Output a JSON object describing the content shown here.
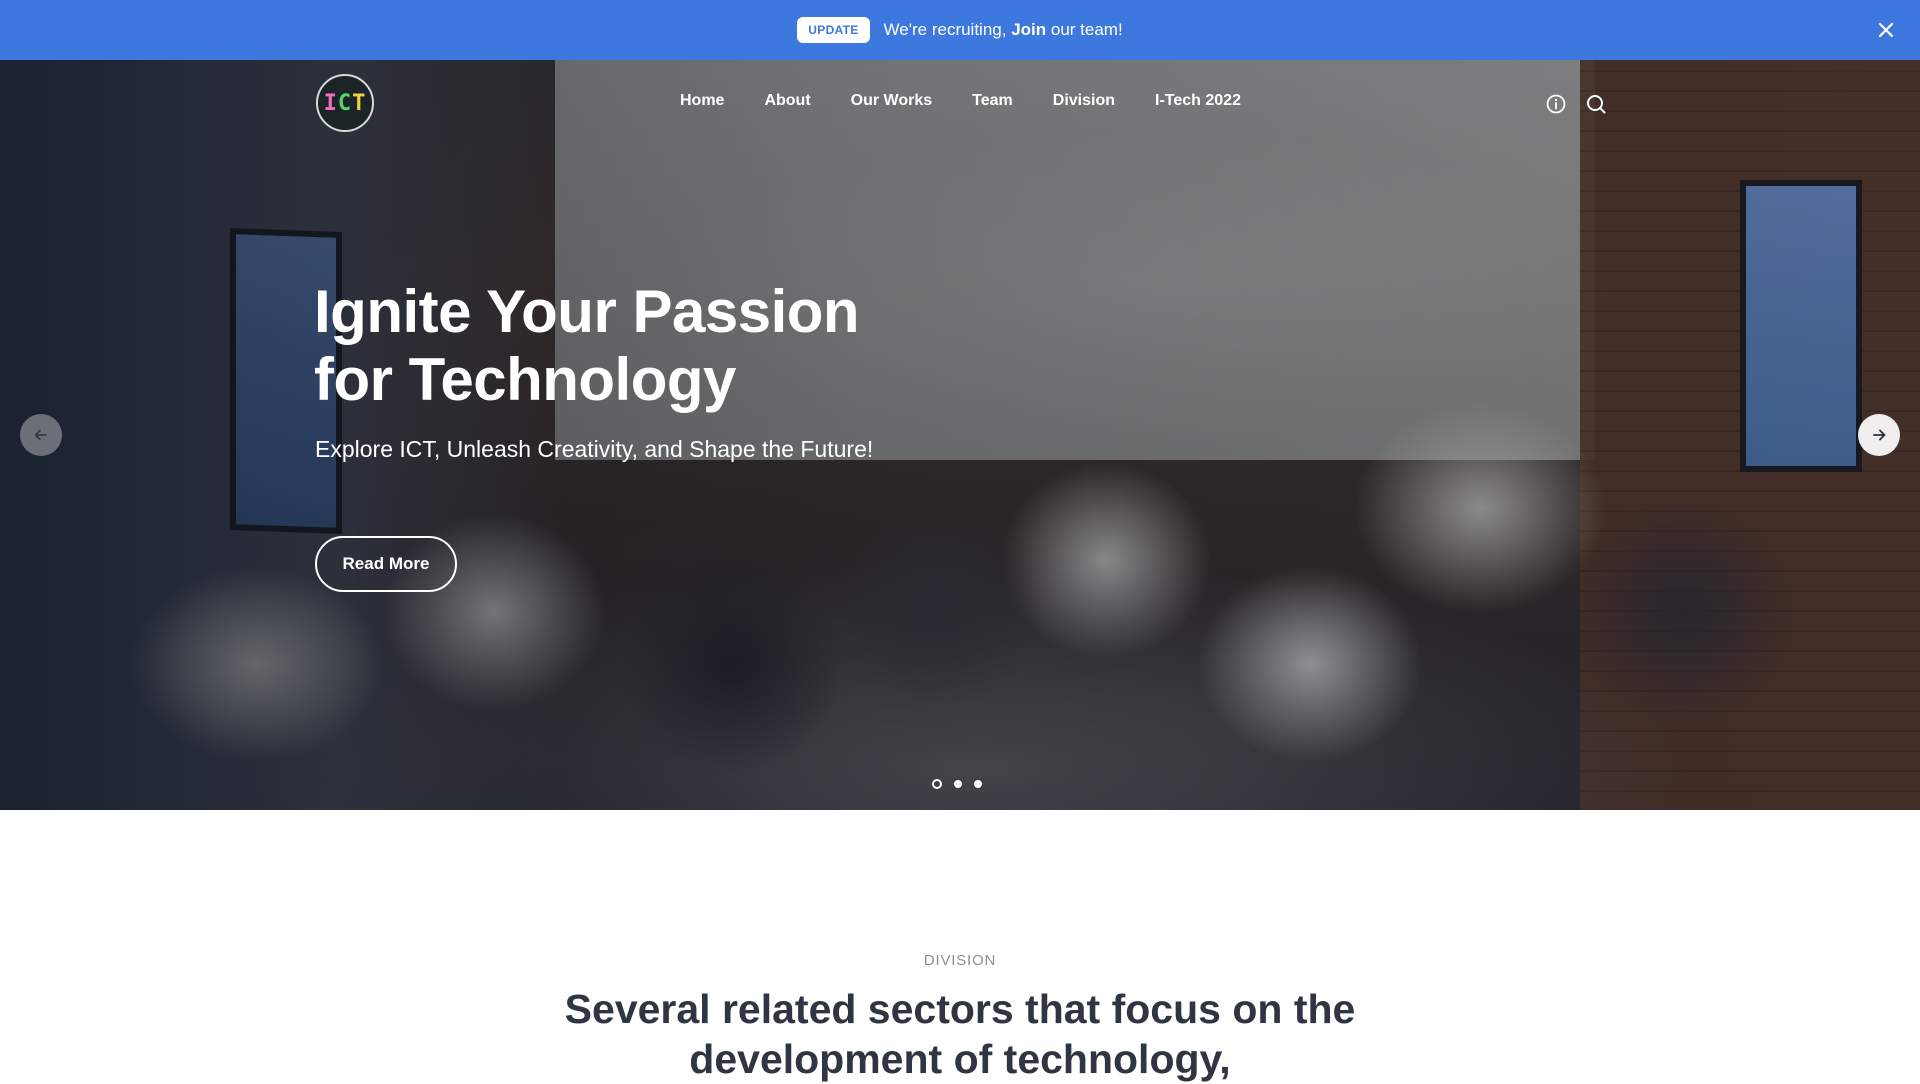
{
  "banner": {
    "badge": "UPDATE",
    "message_prefix": "We're recruiting, ",
    "message_link": "Join",
    "message_suffix": " our team!",
    "close_icon": "close-icon",
    "background": "#3d78df"
  },
  "logo": {
    "part1": "I",
    "part2": "C",
    "part3": "T"
  },
  "nav": {
    "items": [
      "Home",
      "About",
      "Our Works",
      "Team",
      "Division",
      "I-Tech 2022"
    ],
    "icons": [
      "info-icon",
      "search-icon"
    ]
  },
  "hero": {
    "title": "Ignite Your Passion for Technology",
    "subtitle": "Explore ICT, Unleash Creativity, and Shape the Future!",
    "button": "Read More",
    "prev_icon": "arrow-left-icon",
    "next_icon": "arrow-right-icon",
    "slides": 3,
    "active_slide": 1
  },
  "division": {
    "kicker": "DIVISION",
    "title": "Several related sectors that focus on the development of technology,"
  }
}
